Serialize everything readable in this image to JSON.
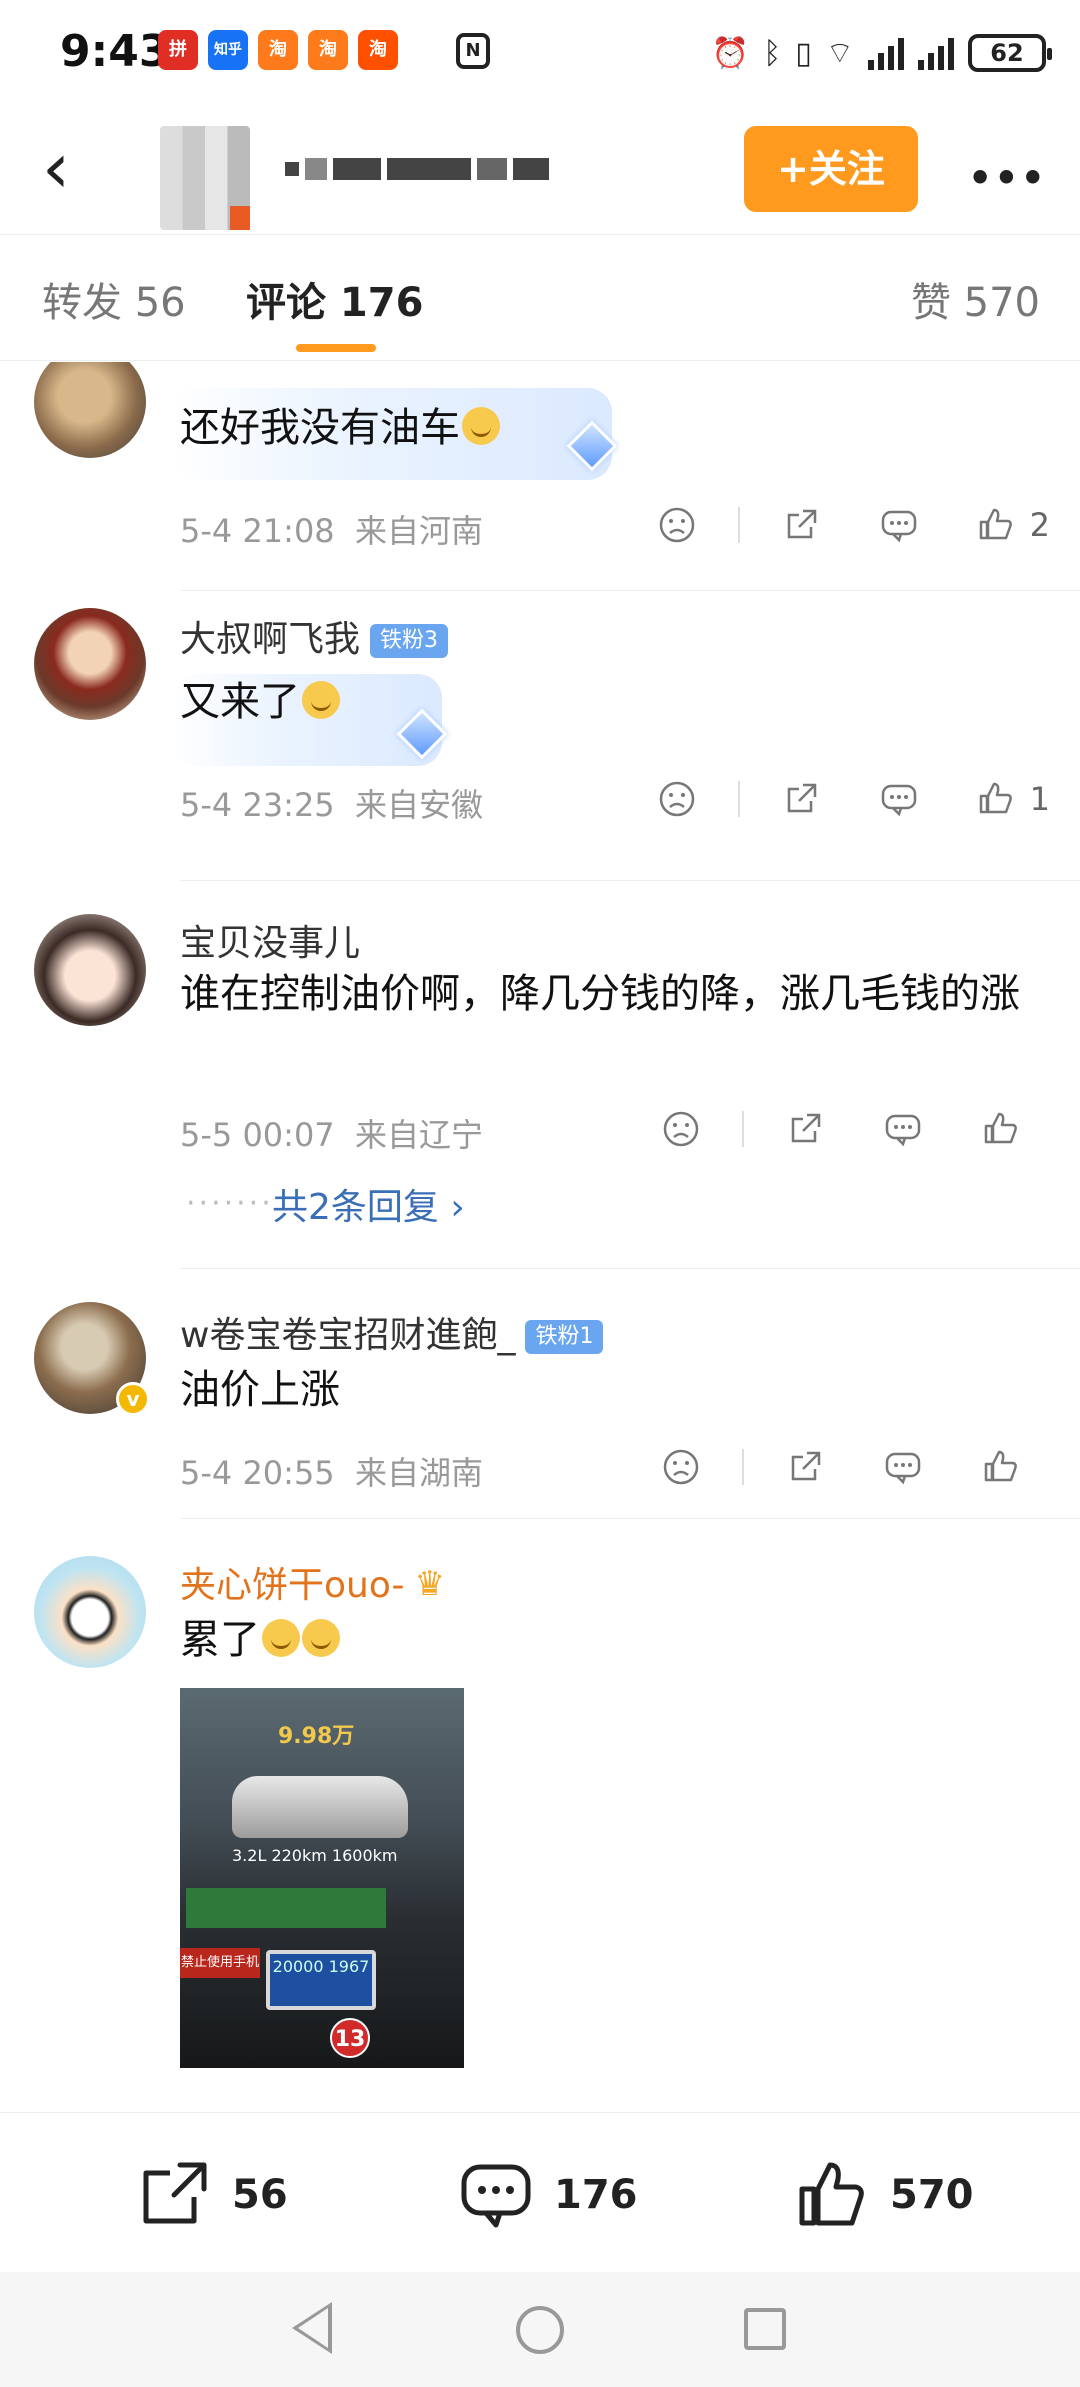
{
  "status_bar": {
    "time": "9:43",
    "apps": [
      {
        "name": "pinduoduo-icon",
        "label": "拼",
        "color": "#e02e24"
      },
      {
        "name": "zhihu-icon",
        "label": "知乎",
        "color": "#1772f6"
      },
      {
        "name": "taobao-special-icon",
        "label": "淘",
        "color": "#ff7a1a"
      },
      {
        "name": "taobao-special-icon-2",
        "label": "淘",
        "color": "#ff7a1a"
      },
      {
        "name": "taobao-icon",
        "label": "淘",
        "color": "#ff5000"
      }
    ],
    "battery": "62"
  },
  "header": {
    "follow_label": "+关注",
    "more_label": "•••"
  },
  "tabs": {
    "repost": "转发 56",
    "comment": "评论 176",
    "like": "赞 570"
  },
  "comments": [
    {
      "name": "",
      "text": "还好我没有油车",
      "time": "5-4 21:08",
      "location": "来自河南",
      "likes": "2"
    },
    {
      "name": "大叔啊飞我",
      "badge": "铁粉3",
      "text": "又来了",
      "time": "5-4 23:25",
      "location": "来自安徽",
      "likes": "1"
    },
    {
      "name": "宝贝没事儿",
      "text": "谁在控制油价啊，降几分钱的降，涨几毛钱的涨",
      "time": "5-5 00:07",
      "location": "来自辽宁",
      "likes": "",
      "replies": "共2条回复 ›"
    },
    {
      "name": "w卷宝卷宝招财進飽_",
      "badge": "铁粉1",
      "text": "油价上涨",
      "time": "5-4 20:55",
      "location": "来自湖南",
      "likes": ""
    },
    {
      "name": "夹心饼干ouo-",
      "text": "累了",
      "image": {
        "price": "9.98万",
        "spec": "3.2L   220km   1600km",
        "pump": "20000 1967",
        "pump_number": "13",
        "warn": "禁止使用手机"
      }
    }
  ],
  "bottom_bar": {
    "repost_count": "56",
    "comment_count": "176",
    "like_count": "570"
  },
  "colors": {
    "accent": "#ff9a1e",
    "link": "#3a6fb7",
    "fan_badge": "#6aa6f0"
  }
}
